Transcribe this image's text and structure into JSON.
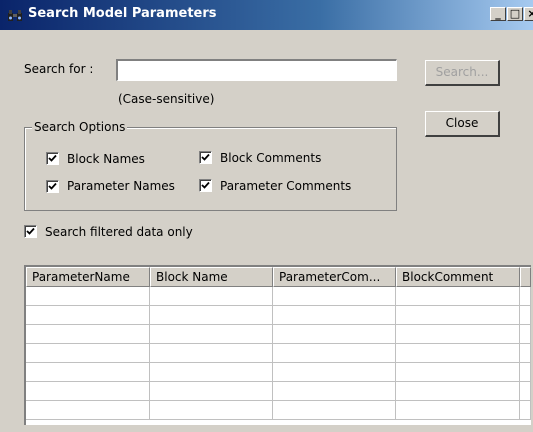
{
  "window": {
    "title": "Search Model Parameters",
    "title_icon": "binoculars-icon",
    "controls": {
      "minimize": "_",
      "maximize": "□",
      "close": "×"
    }
  },
  "search": {
    "label": "Search for :",
    "value": "",
    "hint": "(Case-sensitive)"
  },
  "buttons": {
    "search": "Search...",
    "close": "Close"
  },
  "options": {
    "legend": "Search Options",
    "block_names": {
      "label": "Block Names",
      "checked": true
    },
    "block_comments": {
      "label": "Block Comments",
      "checked": true
    },
    "parameter_names": {
      "label": "Parameter Names",
      "checked": true
    },
    "parameter_comments": {
      "label": "Parameter Comments",
      "checked": true
    }
  },
  "filtered": {
    "label": "Search filtered data only",
    "checked": true
  },
  "results": {
    "columns": [
      "ParameterName",
      "Block Name",
      "ParameterCom...",
      "BlockComment"
    ],
    "rows": []
  },
  "colors": {
    "face": "#d4d0c8",
    "title_start": "#0a246a",
    "title_end": "#a6caf0",
    "disabled_text": "#a0a0a0"
  }
}
